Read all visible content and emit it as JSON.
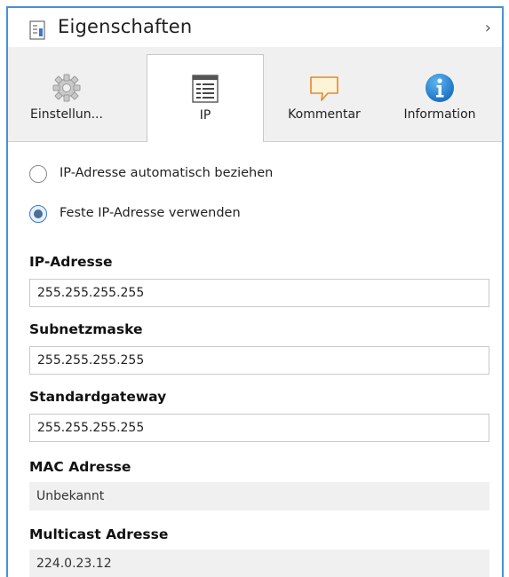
{
  "header": {
    "title": "Eigenschaften",
    "collapse_icon": "chevron-right-icon"
  },
  "tabs": [
    {
      "label": "Einstellun...",
      "icon": "gear-icon"
    },
    {
      "label": "IP",
      "icon": "ip-list-icon",
      "active": true
    },
    {
      "label": "Kommentar",
      "icon": "comment-icon"
    },
    {
      "label": "Information",
      "icon": "info-icon"
    }
  ],
  "ip_mode": {
    "options": [
      {
        "label": "IP-Adresse automatisch beziehen",
        "checked": false
      },
      {
        "label": "Feste IP-Adresse verwenden",
        "checked": true
      }
    ]
  },
  "fields": {
    "ip": {
      "label": "IP-Adresse",
      "value": "255.255.255.255"
    },
    "subnet": {
      "label": "Subnetzmaske",
      "value": "255.255.255.255"
    },
    "gateway": {
      "label": "Standardgateway",
      "value": "255.255.255.255"
    },
    "mac": {
      "label": "MAC Adresse",
      "value": "Unbekannt"
    },
    "multicast": {
      "label": "Multicast Adresse",
      "value": "224.0.23.12"
    }
  },
  "colors": {
    "accent_border": "#4a90d9",
    "tab_bg": "#f0f0f0",
    "readonly_bg": "#f0f0f0"
  }
}
